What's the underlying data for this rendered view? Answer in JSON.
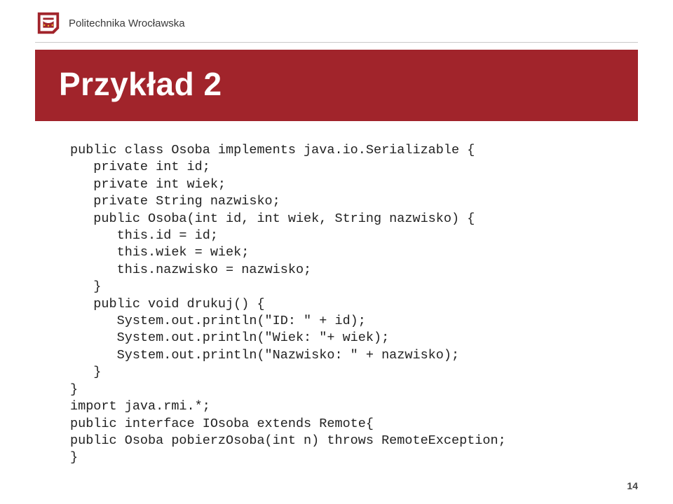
{
  "header": {
    "university": "Politechnika Wrocławska"
  },
  "title": "Przykład 2",
  "code": "public class Osoba implements java.io.Serializable {\n   private int id;\n   private int wiek;\n   private String nazwisko;\n   public Osoba(int id, int wiek, String nazwisko) {\n      this.id = id;\n      this.wiek = wiek;\n      this.nazwisko = nazwisko;\n   }\n   public void drukuj() {\n      System.out.println(\"ID: \" + id);\n      System.out.println(\"Wiek: \"+ wiek);\n      System.out.println(\"Nazwisko: \" + nazwisko);\n   }\n}\nimport java.rmi.*;\npublic interface IOsoba extends Remote{\npublic Osoba pobierzOsoba(int n) throws RemoteException;\n}",
  "page_number": "14"
}
